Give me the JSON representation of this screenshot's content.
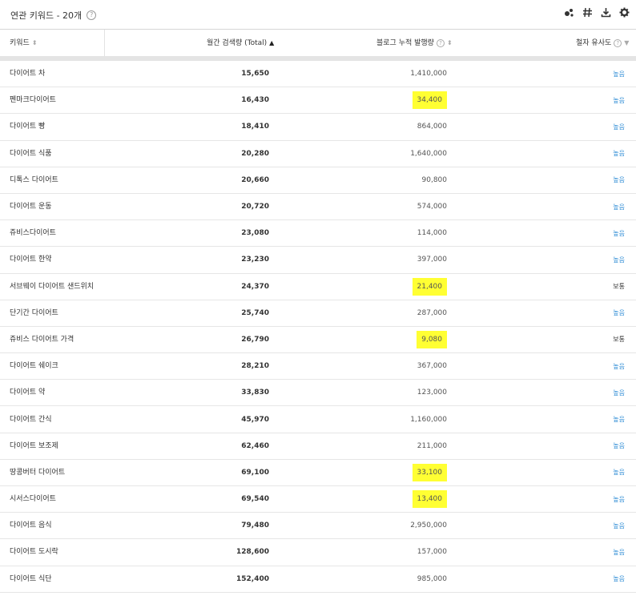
{
  "header": {
    "title": "연관 키워드 - 20개",
    "help": "?"
  },
  "columns": {
    "keyword": "키워드",
    "monthly_volume": "월간 검색량 (Total)",
    "blog_count": "블로그 누적 발행량",
    "similarity": "철자 유사도"
  },
  "rows": [
    {
      "keyword": "다이어트 차",
      "volume": "15,650",
      "blog": "1,410,000",
      "similarity": "높음",
      "highlight": false
    },
    {
      "keyword": "펜마크다이어트",
      "volume": "16,430",
      "blog": "34,400",
      "similarity": "높음",
      "highlight": true
    },
    {
      "keyword": "다이어트 빵",
      "volume": "18,410",
      "blog": "864,000",
      "similarity": "높음",
      "highlight": false
    },
    {
      "keyword": "다이어트 식품",
      "volume": "20,280",
      "blog": "1,640,000",
      "similarity": "높음",
      "highlight": false
    },
    {
      "keyword": "디톡스 다이어트",
      "volume": "20,660",
      "blog": "90,800",
      "similarity": "높음",
      "highlight": false
    },
    {
      "keyword": "다이어트 운동",
      "volume": "20,720",
      "blog": "574,000",
      "similarity": "높음",
      "highlight": false
    },
    {
      "keyword": "쥬비스다이어트",
      "volume": "23,080",
      "blog": "114,000",
      "similarity": "높음",
      "highlight": false
    },
    {
      "keyword": "다이어트 한약",
      "volume": "23,230",
      "blog": "397,000",
      "similarity": "높음",
      "highlight": false
    },
    {
      "keyword": "서브웨이 다이어트 샌드위치",
      "volume": "24,370",
      "blog": "21,400",
      "similarity": "보통",
      "highlight": true
    },
    {
      "keyword": "단기간 다이어트",
      "volume": "25,740",
      "blog": "287,000",
      "similarity": "높음",
      "highlight": false
    },
    {
      "keyword": "쥬비스 다이어트 가격",
      "volume": "26,790",
      "blog": "9,080",
      "similarity": "보통",
      "highlight": true
    },
    {
      "keyword": "다이어트 쉐이크",
      "volume": "28,210",
      "blog": "367,000",
      "similarity": "높음",
      "highlight": false
    },
    {
      "keyword": "다이어트 약",
      "volume": "33,830",
      "blog": "123,000",
      "similarity": "높음",
      "highlight": false
    },
    {
      "keyword": "다이어트 간식",
      "volume": "45,970",
      "blog": "1,160,000",
      "similarity": "높음",
      "highlight": false
    },
    {
      "keyword": "다이어트 보조제",
      "volume": "62,460",
      "blog": "211,000",
      "similarity": "높음",
      "highlight": false
    },
    {
      "keyword": "땅콩버터 다이어트",
      "volume": "69,100",
      "blog": "33,100",
      "similarity": "높음",
      "highlight": true
    },
    {
      "keyword": "시서스다이어트",
      "volume": "69,540",
      "blog": "13,400",
      "similarity": "높음",
      "highlight": true
    },
    {
      "keyword": "다이어트 음식",
      "volume": "79,480",
      "blog": "2,950,000",
      "similarity": "높음",
      "highlight": false
    },
    {
      "keyword": "다이어트 도시락",
      "volume": "128,600",
      "blog": "157,000",
      "similarity": "높음",
      "highlight": false
    },
    {
      "keyword": "다이어트 식단",
      "volume": "152,400",
      "blog": "985,000",
      "similarity": "높음",
      "highlight": false
    }
  ],
  "colors": {
    "highlight": "#ffff33",
    "similarity_high": "#2a8ad4"
  }
}
